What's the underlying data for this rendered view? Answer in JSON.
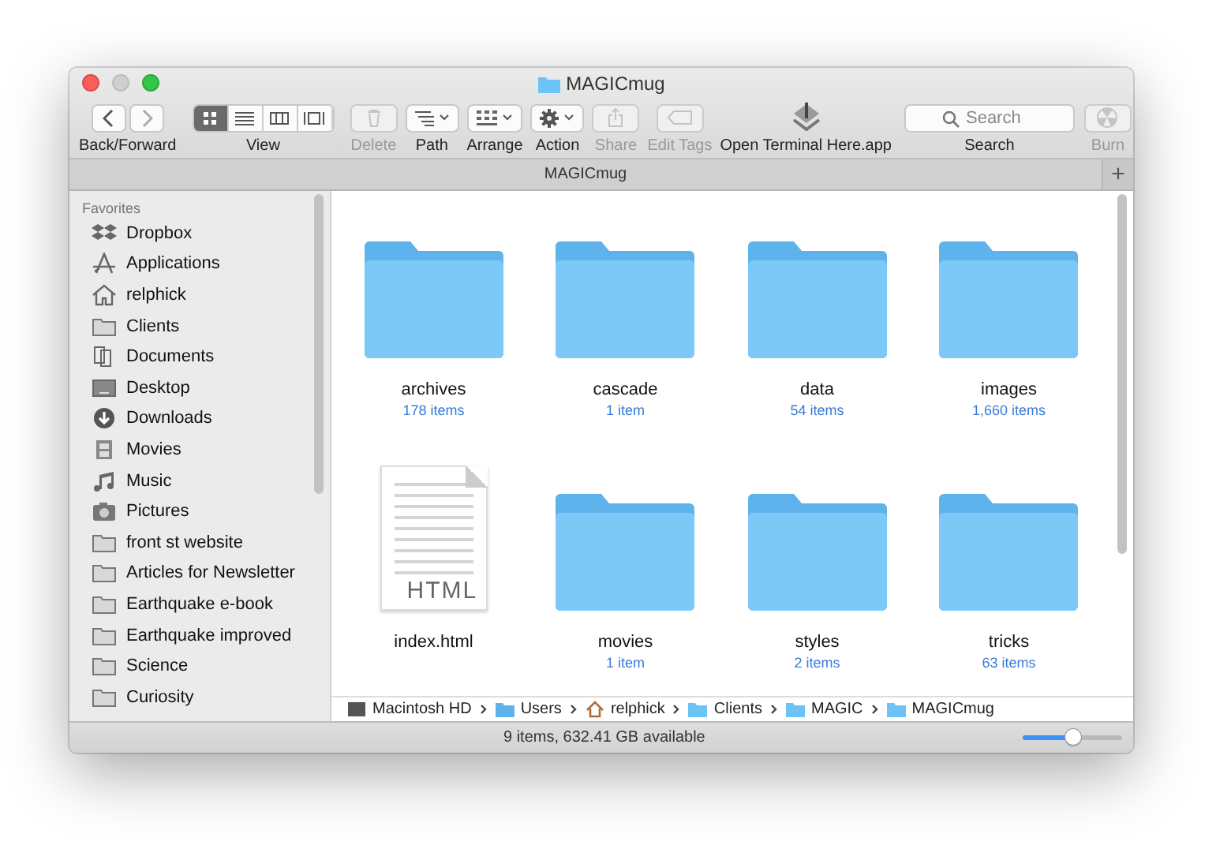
{
  "window": {
    "title": "MAGICmug"
  },
  "toolbar": [
    {
      "kind": "nav",
      "label": "Back/Forward",
      "disabled": false
    },
    {
      "kind": "view",
      "label": "View",
      "disabled": false,
      "segments": [
        {
          "selected": true
        },
        {
          "selected": false
        },
        {
          "selected": false
        },
        {
          "selected": false
        }
      ]
    },
    {
      "kind": "delete",
      "label": "Delete",
      "disabled": true
    },
    {
      "kind": "path",
      "label": "Path",
      "disabled": false
    },
    {
      "kind": "arrange",
      "label": "Arrange",
      "disabled": false
    },
    {
      "kind": "action",
      "label": "Action",
      "disabled": false
    },
    {
      "kind": "share",
      "label": "Share",
      "disabled": true
    },
    {
      "kind": "tags",
      "label": "Edit Tags",
      "disabled": true
    },
    {
      "kind": "app",
      "label": "Open Terminal Here.app",
      "disabled": false
    },
    {
      "kind": "search",
      "label": "Search",
      "placeholder": "Search",
      "disabled": false
    },
    {
      "kind": "burn",
      "label": "Burn",
      "disabled": true
    }
  ],
  "tab_bar": {
    "title": "MAGICmug",
    "add": "+"
  },
  "sidebar": {
    "heading": "Favorites",
    "items": [
      {
        "kind": "dropbox",
        "label": "Dropbox"
      },
      {
        "kind": "applications",
        "label": "Applications"
      },
      {
        "kind": "home",
        "label": "relphick"
      },
      {
        "kind": "folder",
        "label": "Clients"
      },
      {
        "kind": "documents",
        "label": "Documents"
      },
      {
        "kind": "desktop",
        "label": "Desktop"
      },
      {
        "kind": "downloads",
        "label": "Downloads"
      },
      {
        "kind": "movies",
        "label": "Movies"
      },
      {
        "kind": "music",
        "label": "Music"
      },
      {
        "kind": "pictures",
        "label": "Pictures"
      },
      {
        "kind": "folder",
        "label": "front st website"
      },
      {
        "kind": "folder",
        "label": "Articles for Newsletter"
      },
      {
        "kind": "folder",
        "label": "Earthquake e-book"
      },
      {
        "kind": "folder",
        "label": "Earthquake improved"
      },
      {
        "kind": "folder",
        "label": "Science"
      },
      {
        "kind": "folder",
        "label": "Curiosity"
      }
    ]
  },
  "files": [
    {
      "kind": "folder",
      "name": "archives",
      "count": "178 items"
    },
    {
      "kind": "folder",
      "name": "cascade",
      "count": "1 item"
    },
    {
      "kind": "folder",
      "name": "data",
      "count": "54 items"
    },
    {
      "kind": "folder",
      "name": "images",
      "count": "1,660 items"
    },
    {
      "kind": "html",
      "name": "index.html",
      "badge": "HTML"
    },
    {
      "kind": "folder",
      "name": "movies",
      "count": "1 item"
    },
    {
      "kind": "folder",
      "name": "styles",
      "count": "2 items"
    },
    {
      "kind": "folder",
      "name": "tricks",
      "count": "63 items"
    }
  ],
  "path_bar": [
    {
      "kind": "disk",
      "label": "Macintosh HD"
    },
    {
      "kind": "users",
      "label": "Users"
    },
    {
      "kind": "home",
      "label": "relphick"
    },
    {
      "kind": "folder",
      "label": "Clients"
    },
    {
      "kind": "folder",
      "label": "MAGIC"
    },
    {
      "kind": "folder",
      "label": "MAGICmug"
    }
  ],
  "status_bar": {
    "text": "9 items, 632.41 GB available",
    "zoom": {
      "level": 0.5
    }
  }
}
